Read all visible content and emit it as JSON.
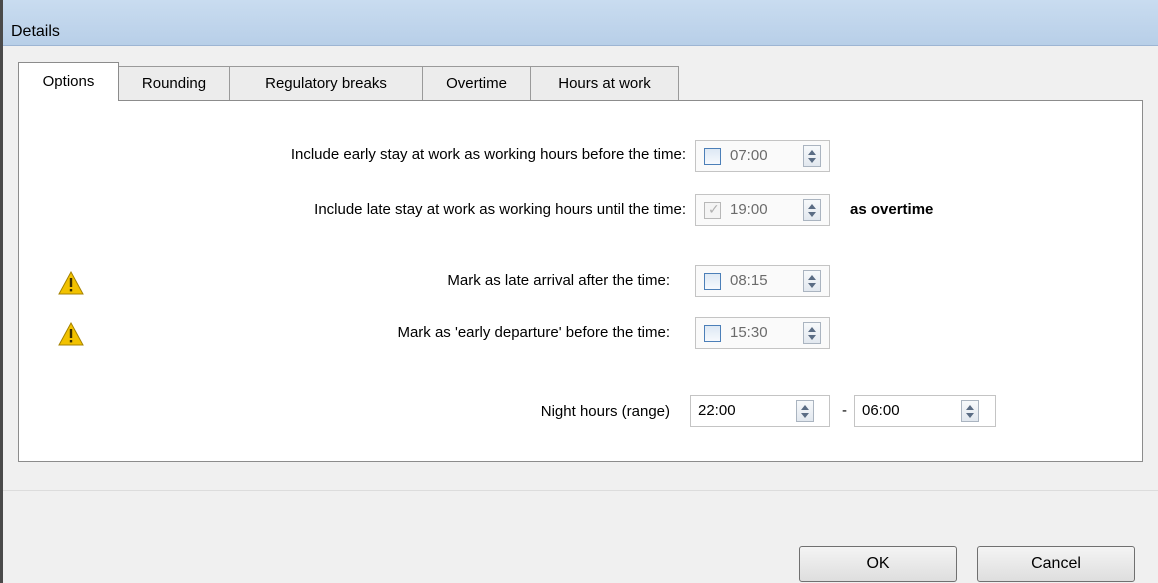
{
  "window": {
    "title": "Details"
  },
  "tabs": [
    {
      "label": "Options",
      "active": true
    },
    {
      "label": "Rounding",
      "active": false
    },
    {
      "label": "Regulatory breaks",
      "active": false
    },
    {
      "label": "Overtime",
      "active": false
    },
    {
      "label": "Hours at work",
      "active": false
    }
  ],
  "options": {
    "early_stay": {
      "label": "Include early stay at work as working hours before the time:",
      "checked": false,
      "time": "07:00"
    },
    "late_stay": {
      "label": "Include late stay at work as working hours until the time:",
      "checked": true,
      "time": "19:00",
      "suffix": "as overtime"
    },
    "late_arrival": {
      "label": "Mark as late arrival after the time:",
      "checked": false,
      "time": "08:15",
      "icon": "warning-icon"
    },
    "early_departure": {
      "label": "Mark as 'early departure' before the time:",
      "checked": false,
      "time": "15:30",
      "icon": "warning-icon"
    },
    "night_hours": {
      "label": "Night hours (range)",
      "from": "22:00",
      "separator": "-",
      "to": "06:00"
    }
  },
  "buttons": {
    "ok": "OK",
    "cancel": "Cancel"
  },
  "colors": {
    "title_bar": "#c9dcf0",
    "checkbox_border": "#4c7fb8",
    "warning": "#f2c200"
  }
}
